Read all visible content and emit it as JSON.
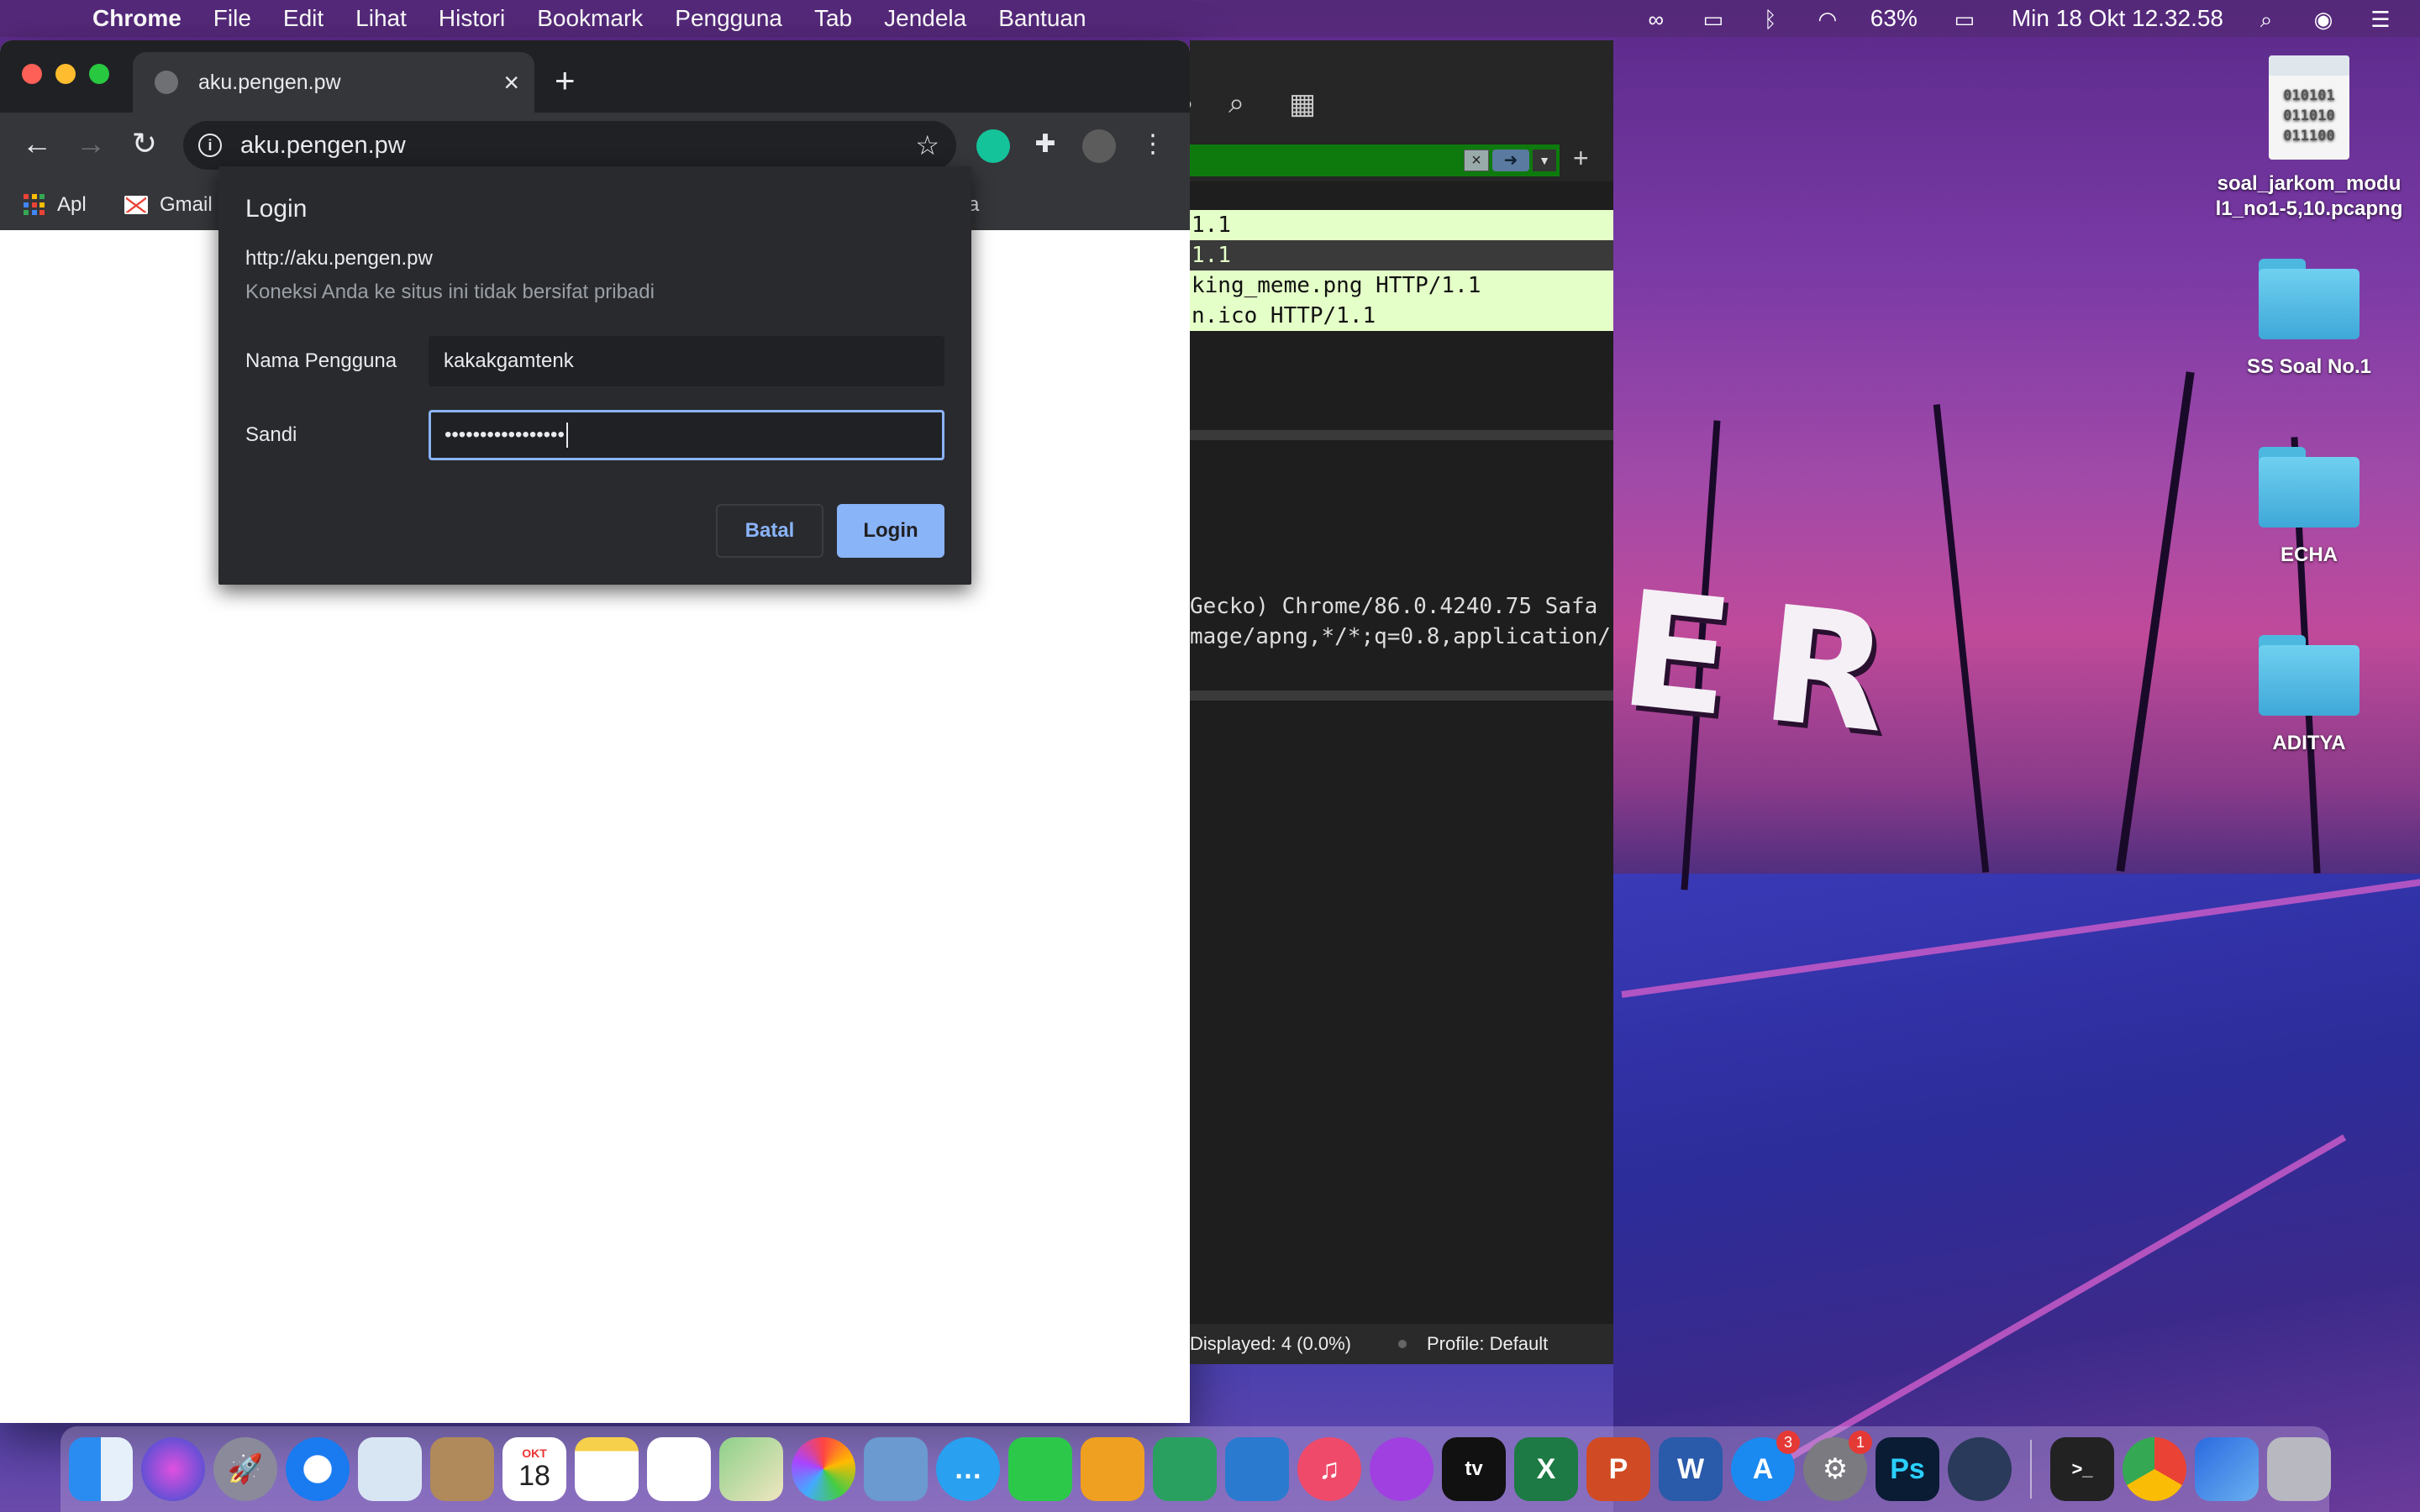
{
  "menubar": {
    "app_name": "Chrome",
    "items": [
      "File",
      "Edit",
      "Lihat",
      "Histori",
      "Bookmark",
      "Pengguna",
      "Tab",
      "Jendela",
      "Bantuan"
    ],
    "battery": "63%",
    "clock": "Min 18 Okt  12.32.58"
  },
  "browser": {
    "tab_title": "aku.pengen.pw",
    "address": "aku.pengen.pw",
    "bookmarks": [
      {
        "label": "Apl",
        "icon": "apps-icon"
      },
      {
        "label": "Gmail",
        "icon": "gmail-icon"
      }
    ],
    "bookmark_overflow_fragment": "a"
  },
  "login_dialog": {
    "title": "Login",
    "url": "http://aku.pengen.pw",
    "warning": "Koneksi Anda ke situs ini tidak bersifat pribadi",
    "username_label": "Nama Pengguna",
    "username_value": "kakakgamtenk",
    "password_label": "Sandi",
    "password_value": "•••••••••••••••••",
    "cancel_label": "Batal",
    "login_label": "Login",
    "accent_color": "#8ab4f8"
  },
  "wireshark": {
    "packet_rows": [
      {
        "text": "1.1",
        "style": "green"
      },
      {
        "text": "1.1",
        "style": "dark"
      },
      {
        "text": "king_meme.png HTTP/1.1",
        "style": "green"
      },
      {
        "text": "n.ico HTTP/1.1",
        "style": "green"
      }
    ],
    "detail_lines": [
      " Gecko) Chrome/86.0.4240.75 Safa",
      "mage/apng,*/*;q=0.8,application/"
    ],
    "status_displayed": "Displayed: 4 (0.0%)",
    "status_profile": "Profile: Default"
  },
  "wallpaper_text": "ER",
  "desktop_items": [
    {
      "label": "soal_jarkom_modu l1_no1-5,10.pcapng",
      "type": "document",
      "content": [
        "010101",
        "011010",
        "011100"
      ]
    },
    {
      "label": "SS Soal No.1",
      "type": "folder"
    },
    {
      "label": "ECHA",
      "type": "folder"
    },
    {
      "label": "ADITYA",
      "type": "folder"
    }
  ],
  "dock": {
    "calendar_month": "OKT",
    "calendar_day": "18",
    "appstore_badge": "3",
    "settings_badge": "1",
    "apps": [
      "finder-icon",
      "siri-icon",
      "launchpad-icon",
      "safari-icon",
      "mail-icon",
      "contacts-icon",
      "calendar-icon",
      "notes-icon",
      "reminders-icon",
      "maps-icon",
      "photos-icon",
      "preview-icon",
      "messages-icon",
      "facetime-icon",
      "pages-icon",
      "numbers-icon",
      "keynote-icon",
      "music-icon",
      "podcasts-icon",
      "tv-icon",
      "excel-icon",
      "powerpoint-icon",
      "word-icon",
      "appstore-icon",
      "system-preferences-icon",
      "photoshop-icon",
      "quicktime-icon",
      "terminal-icon",
      "chrome-icon",
      "wireshark-icon",
      "trash-icon"
    ]
  }
}
